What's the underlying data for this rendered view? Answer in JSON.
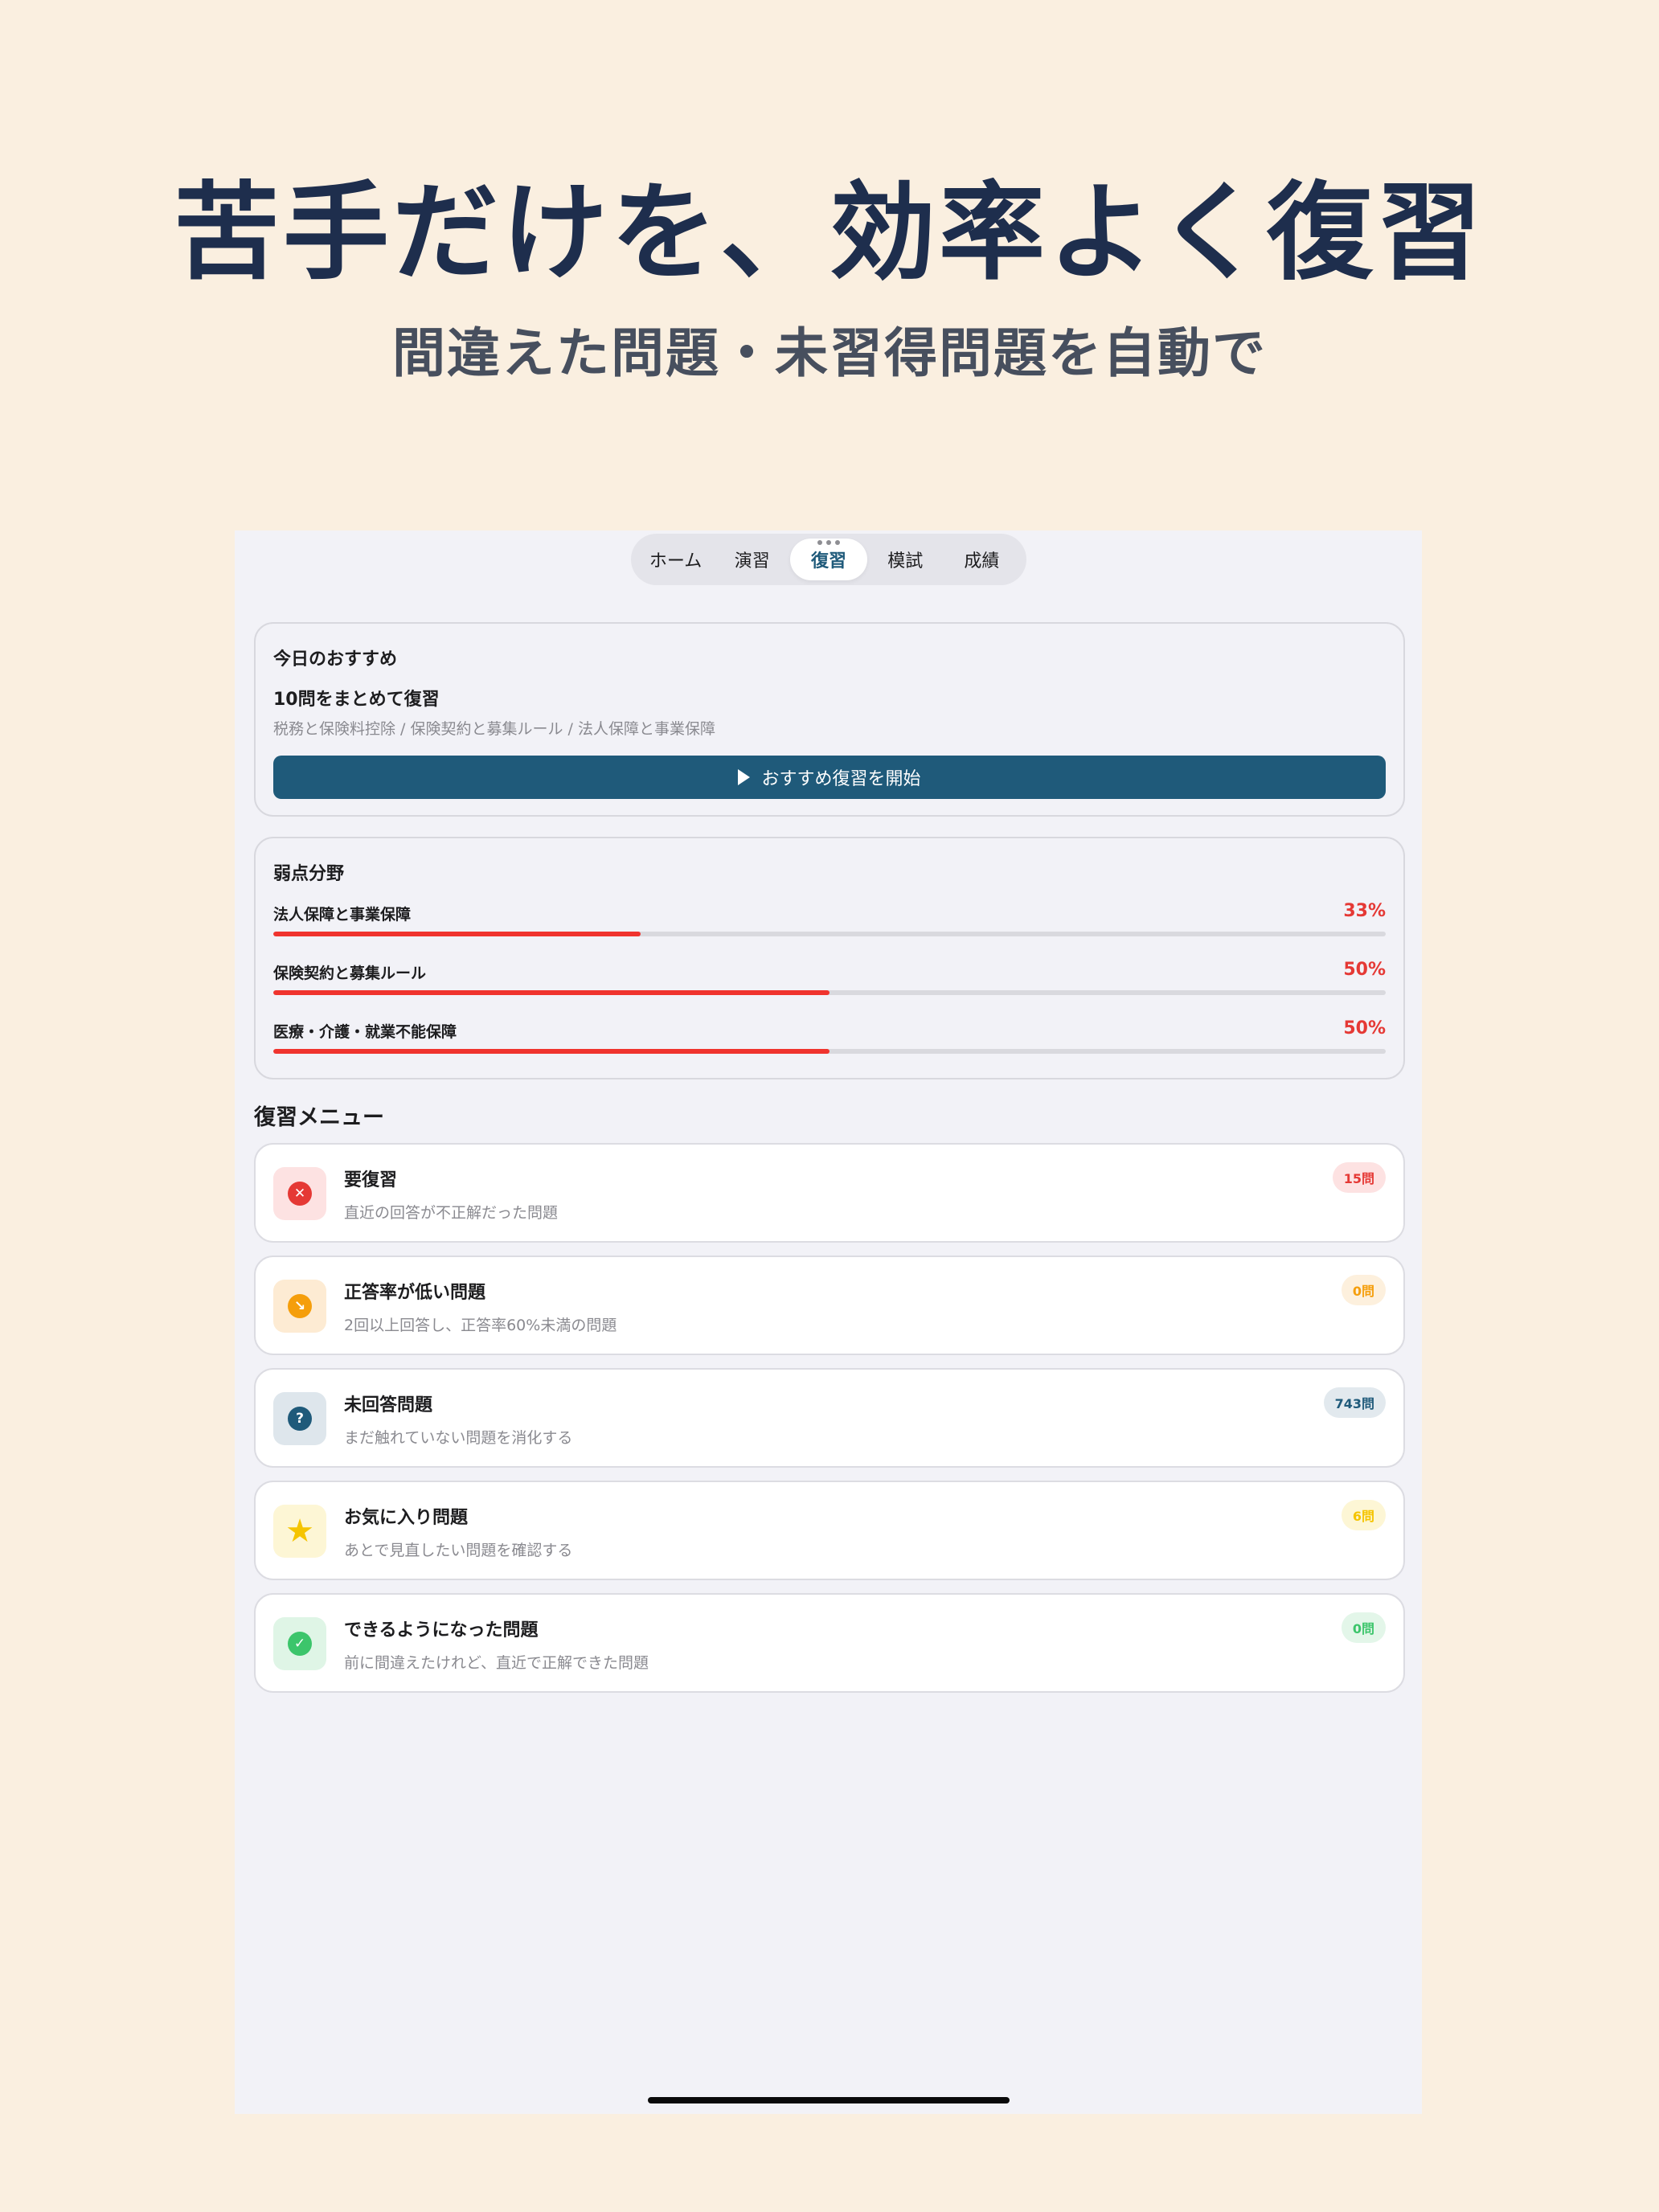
{
  "promo": {
    "headline": "苦手だけを、効率よく復習",
    "subheadline": "間違えた問題・未習得問題を自動で"
  },
  "tabs": [
    {
      "label": "ホーム",
      "active": false
    },
    {
      "label": "演習",
      "active": false
    },
    {
      "label": "復習",
      "active": true
    },
    {
      "label": "模試",
      "active": false
    },
    {
      "label": "成績",
      "active": false
    }
  ],
  "recommendation": {
    "title": "今日のおすすめ",
    "headline": "10問をまとめて復習",
    "subtitle": "税務と保険料控除 / 保険契約と募集ルール / 法人保障と事業保障",
    "button_label": "おすすめ復習を開始",
    "button_icon": "play-icon",
    "button_color": "#1F5A7A"
  },
  "weak_areas": {
    "title": "弱点分野",
    "items": [
      {
        "label": "法人保障と事業保障",
        "percent_text": "33%",
        "percent": 33
      },
      {
        "label": "保険契約と募集ルール",
        "percent_text": "50%",
        "percent": 50
      },
      {
        "label": "医療・介護・就業不能保障",
        "percent_text": "50%",
        "percent": 50
      }
    ],
    "bar_color": "#F0342E"
  },
  "review_menu": {
    "title": "復習メニュー",
    "items": [
      {
        "title": "要復習",
        "description": "直近の回答が不正解だった問題",
        "badge": "15問",
        "icon": "x-circle-icon",
        "glyph": "✕",
        "accent": "#E53935",
        "tint": "#FDE2E2",
        "badge_bg": "#FDE2E2"
      },
      {
        "title": "正答率が低い問題",
        "description": "2回以上回答し、正答率60%未満の問題",
        "badge": "0問",
        "icon": "chart-down-icon",
        "glyph": "↘",
        "accent": "#F59E0B",
        "tint": "#FDEBD3",
        "badge_bg": "#FDF0DD"
      },
      {
        "title": "未回答問題",
        "description": "まだ触れていない問題を消化する",
        "badge": "743問",
        "icon": "question-circle-icon",
        "glyph": "?",
        "accent": "#1F5A7A",
        "tint": "#DEE6EC",
        "badge_bg": "#E2E9EE"
      },
      {
        "title": "お気に入り問題",
        "description": "あとで見直したい問題を確認する",
        "badge": "6問",
        "icon": "star-icon",
        "glyph": "★",
        "accent": "#F5C400",
        "tint": "#FDF6D5",
        "badge_bg": "#FDF6D5"
      },
      {
        "title": "できるようになった問題",
        "description": "前に間違えたけれど、直近で正解できた問題",
        "badge": "0問",
        "icon": "check-badge-icon",
        "glyph": "✓",
        "accent": "#3CC56B",
        "tint": "#DFF5E6",
        "badge_bg": "#E3F6E9"
      }
    ]
  }
}
